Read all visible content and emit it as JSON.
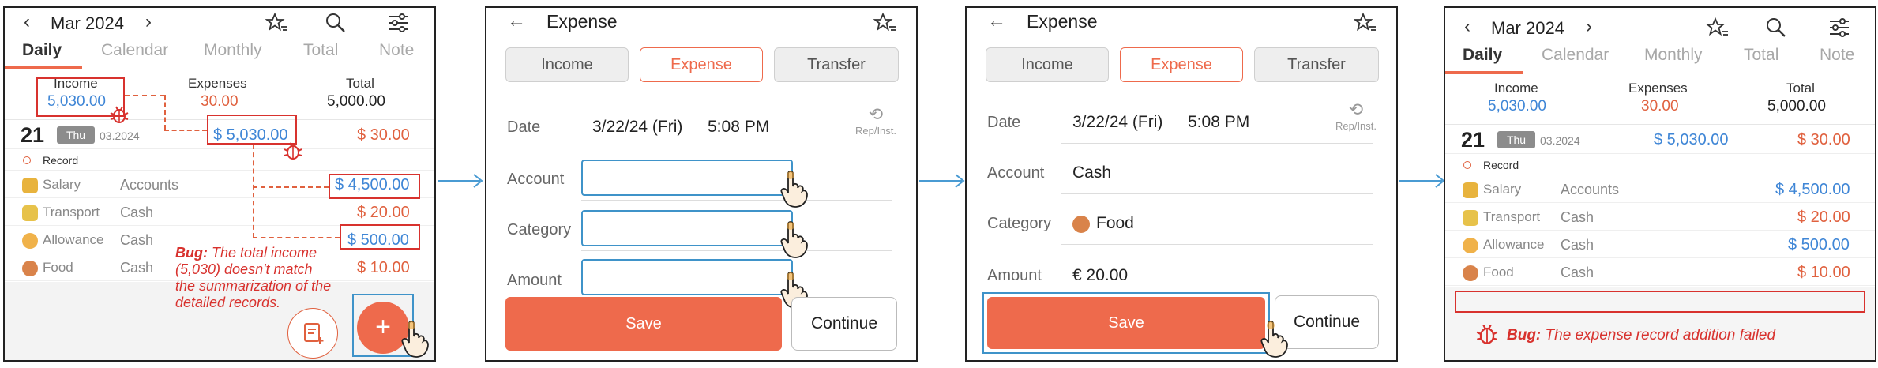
{
  "home": {
    "month": "Mar 2024",
    "tabs": [
      "Daily",
      "Calendar",
      "Monthly",
      "Total",
      "Note"
    ],
    "summary": {
      "income_label": "Income",
      "expenses_label": "Expenses",
      "total_label": "Total",
      "income": "5,030.00",
      "expenses": "30.00",
      "total": "5,000.00"
    },
    "day": {
      "num": "21",
      "weekday": "Thu",
      "date": "03.2024",
      "income": "$ 5,030.00",
      "expense": "$ 30.00"
    },
    "record_label": "Record",
    "rows": [
      {
        "category": "Salary",
        "account": "Accounts",
        "amount": "$ 4,500.00",
        "type": "income"
      },
      {
        "category": "Transport",
        "account": "Cash",
        "amount": "$ 20.00",
        "type": "expense"
      },
      {
        "category": "Allowance",
        "account": "Cash",
        "amount": "$ 500.00",
        "type": "income"
      },
      {
        "category": "Food",
        "account": "Cash",
        "amount": "$ 10.00",
        "type": "expense"
      }
    ],
    "fab_plus": "+"
  },
  "bug1": {
    "label": "Bug:",
    "text": "The total income (5,030) doesn't match the summarization of the detailed records."
  },
  "form_empty": {
    "title": "Expense",
    "types": [
      "Income",
      "Expense",
      "Transfer"
    ],
    "date_label": "Date",
    "date_value": "3/22/24 (Fri)",
    "time_value": "5:08 PM",
    "rep_label": "Rep/Inst.",
    "account_label": "Account",
    "category_label": "Category",
    "amount_label": "Amount",
    "save_label": "Save",
    "continue_label": "Continue"
  },
  "form_filled": {
    "title": "Expense",
    "types": [
      "Income",
      "Expense",
      "Transfer"
    ],
    "date_label": "Date",
    "date_value": "3/22/24 (Fri)",
    "time_value": "5:08 PM",
    "rep_label": "Rep/Inst.",
    "account_label": "Account",
    "account_value": "Cash",
    "category_label": "Category",
    "category_value": "Food",
    "amount_label": "Amount",
    "amount_value": "€ 20.00",
    "save_label": "Save",
    "continue_label": "Continue"
  },
  "bug2": {
    "label": "Bug:",
    "text": "The expense record addition failed"
  },
  "colors": {
    "accent": "#ee6a4c",
    "income_blue": "#3f86d6",
    "bug_red": "#d8322e",
    "focus_blue": "#3f93c9"
  }
}
